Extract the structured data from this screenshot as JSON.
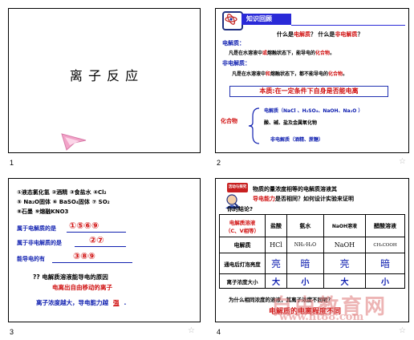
{
  "slide1": {
    "number": "1",
    "title": "离 子 反 应"
  },
  "slide2": {
    "number": "2",
    "header": "知识回顾",
    "question": "什么是电解质？ 什么是非电解质？",
    "q_pre": "什么是",
    "q_red1": "电解质",
    "q_mid": "？ 什么是",
    "q_red2": "非电解质",
    "q_end": "？",
    "label_electrolyte": "电解质：",
    "def_electrolyte_pre": "凡是在水溶液中",
    "def_electrolyte_red": "或",
    "def_electrolyte_mid": "熔融状态下，能导电的",
    "def_electrolyte_red2": "化合物",
    "def_electrolyte_end": "。",
    "label_nonelectrolyte": "非电解质：",
    "def_non_pre": "凡是在水溶液中",
    "def_non_red": "和",
    "def_non_mid": "熔融状态下，都不能导电的",
    "def_non_red2": "化合物",
    "def_non_end": "。",
    "essence": "本质:在一定条件下自身是否能电离",
    "compound_label": "化合物",
    "branch1": "电解质（NaCl 、H₂SO₄、NaOH、Na₂O ）",
    "branch1_detail": "酸、碱、盐及金属氧化物",
    "branch2": "非电解质（酒精、蔗糖）"
  },
  "slide3": {
    "number": "3",
    "list_line1": "①液态氯化氢    ②酒精    ③食盐水    ④Cl₂",
    "list_line2": "⑤ Na₂O固体    ⑥ BaSO₄固体    ⑦ SO₂",
    "list_line3": "⑧石墨    ⑨熔融KNO3",
    "q1_label": "属于电解质的是",
    "q1_answer": "①⑤⑥⑨",
    "q2_label": "属于非电解质的是",
    "q2_answer": "②⑦",
    "q3_label": "能导电的有",
    "q3_answer": "③⑧⑨",
    "question": "?? 电解质溶液能导电的原因",
    "reason": "电离出自由移动的离子",
    "conclusion_pre": "离子浓度越大，导电能力越",
    "conclusion_answer": "强"
  },
  "slide4": {
    "number": "4",
    "badge": "活动与探究",
    "intro_line1": "物质的量浓度相等的电解质溶液其",
    "intro_line2_red": "导电能力",
    "intro_line2_rest": "是否相同？如何设计实验来证明",
    "intro_line3": "你的结论?",
    "table": {
      "header": [
        "电解质溶液\n（C、V相等）",
        "盐酸",
        "氨水",
        "NaOH溶液",
        "醋酸溶液"
      ],
      "row1_label": "电解质",
      "row1": [
        "HCl",
        "NH₃·H₂O",
        "NaOH",
        "CH₃COOH"
      ],
      "row2_label": "通电后灯泡亮度",
      "row2": [
        "亮",
        "暗",
        "亮",
        "暗"
      ],
      "row3_label": "离子浓度大小",
      "row3": [
        "大",
        "小",
        "大",
        "小"
      ]
    },
    "question": "为什么相同浓度的溶液，其离子浓度不同呢？",
    "answer": "电解质的电离程度不同"
  },
  "watermark": {
    "cn": "自由教育网",
    "url": "www.ht88.com"
  },
  "colors": {
    "red": "#d01010",
    "blue": "#1020b0",
    "slide4_title_bg": "#2a2ad8"
  }
}
